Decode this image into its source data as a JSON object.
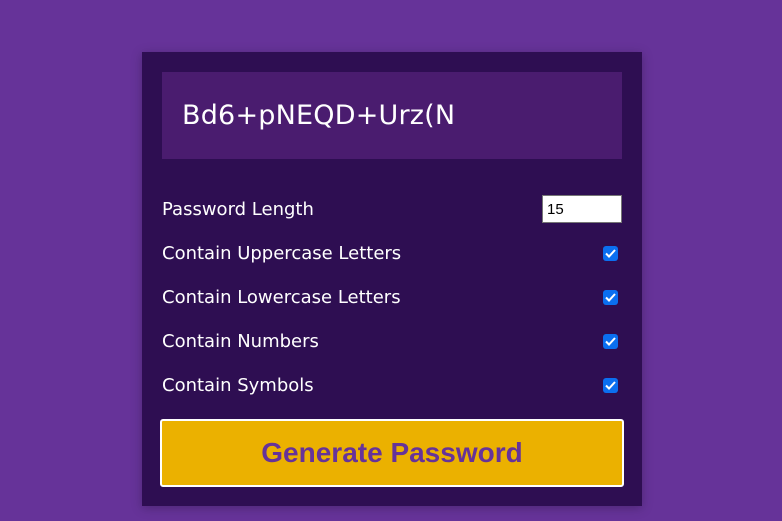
{
  "generator": {
    "password": "Bd6+pNEQD+Urz(N",
    "length_label": "Password Length",
    "length_value": "15",
    "options": [
      {
        "label": "Contain Uppercase Letters",
        "checked": true
      },
      {
        "label": "Contain Lowercase Letters",
        "checked": true
      },
      {
        "label": "Contain Numbers",
        "checked": true
      },
      {
        "label": "Contain Symbols",
        "checked": true
      }
    ],
    "generate_label": "Generate Password"
  },
  "colors": {
    "page_background": "#663399",
    "card_background": "#2e0e52",
    "result_background": "#4a1c6f",
    "button_background": "#ebb100",
    "button_text": "#663399",
    "checkbox_accent": "#0b6ff0"
  },
  "icons": {
    "checkbox": "checkmark-icon"
  }
}
